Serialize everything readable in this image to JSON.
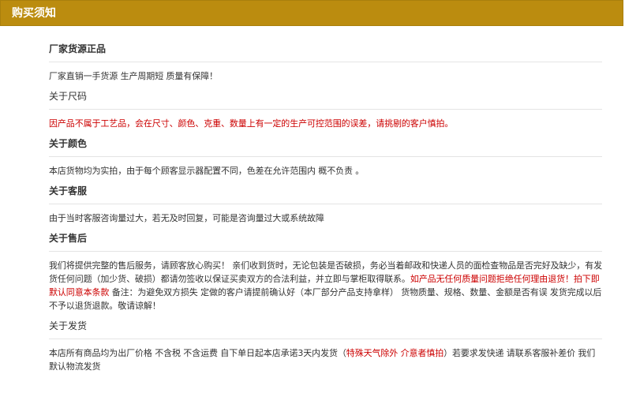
{
  "header": {
    "title": "购买须知"
  },
  "sections": [
    {
      "heading": "厂家货源正品",
      "body": [
        {
          "text": "厂家直销一手货源 生产周期短 质量有保障！",
          "red": false
        }
      ]
    },
    {
      "heading": "关于尺码",
      "body": [
        {
          "text": "因产品不属于工艺品，会在尺寸、颜色、克重、数量上有一定的生产可控范围的误差，请挑剔的客户慎拍。",
          "red": true
        }
      ]
    },
    {
      "heading": "关于颜色",
      "body": [
        {
          "text": "本店货物均为实拍，由于每个顾客显示器配置不同，色差在允许范围内  概不负责 。",
          "red": false
        }
      ]
    },
    {
      "heading": "关于客服",
      "body": [
        {
          "text": "由于当时客服咨询量过大，若无及时回复，可能是咨询量过大或系统故障",
          "red": false
        }
      ]
    },
    {
      "heading": "关于售后",
      "body": [
        {
          "text": "我们将提供完整的售后服务，请顾客放心购买！ 亲们收到货时，无论包装是否破损，务必当着邮政和快递人员的面检查物品是否完好及缺少，有发货任何问题（加少货、破损）都请勿签收以保证买卖双方的合法利益，并立即与掌柜取得联系。",
          "red": false
        },
        {
          "text": "如产品无任何质量问题拒绝任何理由退货！拍下即默认同意本条款",
          "red": true
        },
        {
          "text": " 备注：为避免双方损失 定做的客户请提前确认好（本厂部分产品支持拿样） 货物质量、规格、数量、金额是否有误 发货完成以后 不予以退货退款。敬请谅解！",
          "red": false
        }
      ]
    },
    {
      "heading": "关于发货",
      "body": [
        {
          "text": " 本店所有商品均为出厂价格  不含税 不含运费  自下单日起本店承诺3天内发货（",
          "red": false
        },
        {
          "text": "特殊天气除外 介意者慎拍",
          "red": true
        },
        {
          "text": "）若要求发快递 请联系客服补差价  我们默认物流发货",
          "red": false
        }
      ]
    }
  ]
}
